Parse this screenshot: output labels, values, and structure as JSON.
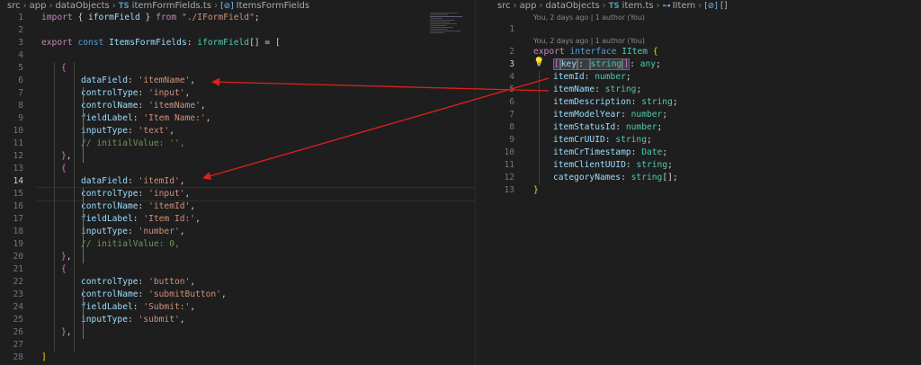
{
  "left_pane": {
    "breadcrumbs": [
      "src",
      "app",
      "dataObjects",
      "itemFormFields.ts",
      "ItemsFormFields"
    ],
    "ts_badge": "TS",
    "active_line": 14,
    "lines": [
      {
        "n": "1",
        "t": [
          [
            "kw",
            "import "
          ],
          [
            "pun",
            "{ "
          ],
          [
            "id",
            "iformField"
          ],
          [
            "pun",
            " } "
          ],
          [
            "kw",
            "from "
          ],
          [
            "str",
            "\"./IFormField\""
          ],
          [
            "pun",
            ";"
          ]
        ]
      },
      {
        "n": "2",
        "t": []
      },
      {
        "n": "3",
        "t": [
          [
            "kw",
            "export "
          ],
          [
            "kw2",
            "const "
          ],
          [
            "id",
            "ItemsFormFields"
          ],
          [
            "pun",
            ": "
          ],
          [
            "ty",
            "iformField"
          ],
          [
            "pun",
            "[] = "
          ],
          [
            "br1",
            "["
          ]
        ]
      },
      {
        "n": "4",
        "t": []
      },
      {
        "n": "5",
        "t": [
          [
            "br2",
            "{"
          ]
        ]
      },
      {
        "n": "6",
        "t": [
          [
            "id",
            "dataField"
          ],
          [
            "pun",
            ": "
          ],
          [
            "str",
            "'itemName'"
          ],
          [
            "pun",
            ","
          ]
        ]
      },
      {
        "n": "7",
        "t": [
          [
            "id",
            "controlType"
          ],
          [
            "pun",
            ": "
          ],
          [
            "str",
            "'input'"
          ],
          [
            "pun",
            ","
          ]
        ]
      },
      {
        "n": "8",
        "t": [
          [
            "id",
            "controlName"
          ],
          [
            "pun",
            ": "
          ],
          [
            "str",
            "'itemName'"
          ],
          [
            "pun",
            ","
          ]
        ]
      },
      {
        "n": "9",
        "t": [
          [
            "id",
            "fieldLabel"
          ],
          [
            "pun",
            ": "
          ],
          [
            "str",
            "'Item Name:'"
          ],
          [
            "pun",
            ","
          ]
        ]
      },
      {
        "n": "10",
        "t": [
          [
            "id",
            "inputType"
          ],
          [
            "pun",
            ": "
          ],
          [
            "str",
            "'text'"
          ],
          [
            "pun",
            ","
          ]
        ]
      },
      {
        "n": "11",
        "t": [
          [
            "cm",
            "// initialValue: '',"
          ]
        ]
      },
      {
        "n": "12",
        "t": [
          [
            "br2",
            "}"
          ],
          [
            "pun",
            ","
          ]
        ]
      },
      {
        "n": "13",
        "t": [
          [
            "br2",
            "{"
          ]
        ]
      },
      {
        "n": "14",
        "t": [
          [
            "id",
            "dataField"
          ],
          [
            "pun",
            ": "
          ],
          [
            "str",
            "'itemId'"
          ],
          [
            "pun",
            ","
          ]
        ]
      },
      {
        "n": "15",
        "t": [
          [
            "id",
            "controlType"
          ],
          [
            "pun",
            ": "
          ],
          [
            "str",
            "'input'"
          ],
          [
            "pun",
            ","
          ]
        ]
      },
      {
        "n": "16",
        "t": [
          [
            "id",
            "controlName"
          ],
          [
            "pun",
            ": "
          ],
          [
            "str",
            "'itemId'"
          ],
          [
            "pun",
            ","
          ]
        ]
      },
      {
        "n": "17",
        "t": [
          [
            "id",
            "fieldLabel"
          ],
          [
            "pun",
            ": "
          ],
          [
            "str",
            "'Item Id:'"
          ],
          [
            "pun",
            ","
          ]
        ]
      },
      {
        "n": "18",
        "t": [
          [
            "id",
            "inputType"
          ],
          [
            "pun",
            ": "
          ],
          [
            "str",
            "'number'"
          ],
          [
            "pun",
            ","
          ]
        ]
      },
      {
        "n": "19",
        "t": [
          [
            "cm",
            "// initialValue: 0,"
          ]
        ]
      },
      {
        "n": "20",
        "t": [
          [
            "br2",
            "}"
          ],
          [
            "pun",
            ","
          ]
        ]
      },
      {
        "n": "21",
        "t": [
          [
            "br2",
            "{"
          ]
        ]
      },
      {
        "n": "22",
        "t": [
          [
            "id",
            "controlType"
          ],
          [
            "pun",
            ": "
          ],
          [
            "str",
            "'button'"
          ],
          [
            "pun",
            ","
          ]
        ]
      },
      {
        "n": "23",
        "t": [
          [
            "id",
            "controlName"
          ],
          [
            "pun",
            ": "
          ],
          [
            "str",
            "'submitButton'"
          ],
          [
            "pun",
            ","
          ]
        ]
      },
      {
        "n": "24",
        "t": [
          [
            "id",
            "fieldLabel"
          ],
          [
            "pun",
            ": "
          ],
          [
            "str",
            "'Submit:'"
          ],
          [
            "pun",
            ","
          ]
        ]
      },
      {
        "n": "25",
        "t": [
          [
            "id",
            "inputType"
          ],
          [
            "pun",
            ": "
          ],
          [
            "str",
            "'submit'"
          ],
          [
            "pun",
            ","
          ]
        ]
      },
      {
        "n": "26",
        "t": [
          [
            "br2",
            "}"
          ],
          [
            "pun",
            ","
          ]
        ]
      },
      {
        "n": "27",
        "t": []
      },
      {
        "n": "28",
        "t": [
          [
            "br1",
            "]"
          ]
        ]
      }
    ]
  },
  "right_pane": {
    "breadcrumbs": [
      "src",
      "app",
      "dataObjects",
      "item.ts",
      "IItem",
      "[]"
    ],
    "ts_badge": "TS",
    "active_line": 3,
    "blame_top": "You, 2 days ago | 1 author (You)",
    "blame_mid": "You, 2 days ago | 1 author (You)",
    "lines": [
      {
        "n": "1",
        "t": []
      },
      {
        "n": "2",
        "t": [
          [
            "kw",
            "export "
          ],
          [
            "kw2",
            "interface "
          ],
          [
            "ty",
            "IItem "
          ],
          [
            "br1",
            "{"
          ]
        ]
      },
      {
        "n": "3",
        "t": [
          [
            "br2",
            "["
          ],
          [
            "id",
            "key"
          ],
          [
            "pun",
            ": "
          ],
          [
            "ty",
            "string"
          ],
          [
            "br2",
            "]"
          ],
          [
            "pun",
            ": "
          ],
          [
            "ty",
            "any"
          ],
          [
            "pun",
            ";"
          ]
        ]
      },
      {
        "n": "4",
        "t": [
          [
            "id",
            "itemId"
          ],
          [
            "pun",
            ": "
          ],
          [
            "ty",
            "number"
          ],
          [
            "pun",
            ";"
          ]
        ]
      },
      {
        "n": "5",
        "t": [
          [
            "id",
            "itemName"
          ],
          [
            "pun",
            ": "
          ],
          [
            "ty",
            "string"
          ],
          [
            "pun",
            ";"
          ]
        ]
      },
      {
        "n": "6",
        "t": [
          [
            "id",
            "itemDescription"
          ],
          [
            "pun",
            ": "
          ],
          [
            "ty",
            "string"
          ],
          [
            "pun",
            ";"
          ]
        ]
      },
      {
        "n": "7",
        "t": [
          [
            "id",
            "itemModelYear"
          ],
          [
            "pun",
            ": "
          ],
          [
            "ty",
            "number"
          ],
          [
            "pun",
            ";"
          ]
        ]
      },
      {
        "n": "8",
        "t": [
          [
            "id",
            "itemStatusId"
          ],
          [
            "pun",
            ": "
          ],
          [
            "ty",
            "number"
          ],
          [
            "pun",
            ";"
          ]
        ]
      },
      {
        "n": "9",
        "t": [
          [
            "id",
            "itemCrUUID"
          ],
          [
            "pun",
            ": "
          ],
          [
            "ty",
            "string"
          ],
          [
            "pun",
            ";"
          ]
        ]
      },
      {
        "n": "10",
        "t": [
          [
            "id",
            "itemCrTimestamp"
          ],
          [
            "pun",
            ": "
          ],
          [
            "ty",
            "Date"
          ],
          [
            "pun",
            ";"
          ]
        ]
      },
      {
        "n": "11",
        "t": [
          [
            "id",
            "itemClientUUID"
          ],
          [
            "pun",
            ": "
          ],
          [
            "ty",
            "string"
          ],
          [
            "pun",
            ";"
          ]
        ]
      },
      {
        "n": "12",
        "t": [
          [
            "id",
            "categoryNames"
          ],
          [
            "pun",
            ": "
          ],
          [
            "ty",
            "string"
          ],
          [
            "pun",
            "[];"
          ]
        ]
      },
      {
        "n": "13",
        "t": [
          [
            "br1",
            "}"
          ]
        ]
      }
    ]
  },
  "icons": {
    "lightbulb": "lightbulb-icon",
    "symbol": "symbol-variable-icon",
    "interface": "symbol-interface-icon",
    "chevron": "chevron-right-icon"
  },
  "colors": {
    "annotation_arrow": "#e0201b",
    "background": "#1e1e1e"
  }
}
